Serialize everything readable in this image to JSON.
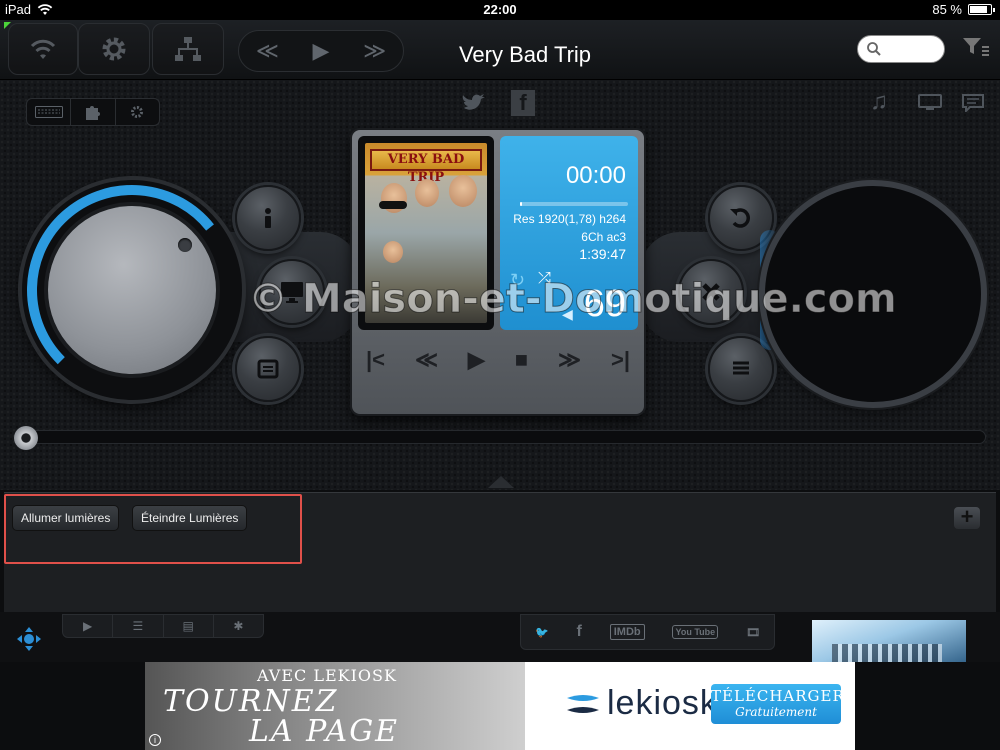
{
  "status_bar": {
    "device": "iPad",
    "time": "22:00",
    "battery": "85 %",
    "battery_level": 0.85
  },
  "now_playing": {
    "title": "Very Bad Trip",
    "poster_text": "VERY BAD TRIP",
    "elapsed": "00:00",
    "progress": 0.0,
    "resolution": "Res 1920(1,78) h264",
    "audio": "6Ch ac3",
    "duration": "1:39:47",
    "volume": "69"
  },
  "seek_position": 0.0,
  "commands": {
    "buttons": [
      {
        "label": "Allumer lumières"
      },
      {
        "label": "Éteindre Lumières"
      }
    ],
    "add_label": "+"
  },
  "watermark": "© Maison-et-Domotique.com",
  "lower_bar": {
    "imdb": "IMDb",
    "youtube": "You Tube"
  },
  "ad": {
    "pre": "AVEC LEKIOSK",
    "line1": "TOURNEZ",
    "line2": "LA PAGE",
    "brand": "lekiosk",
    "cta_1": "TÉLÉCHARGER",
    "cta_2": "Gratuitement"
  },
  "colors": {
    "accent": "#2c9be0",
    "highlight": "#e0504a"
  }
}
